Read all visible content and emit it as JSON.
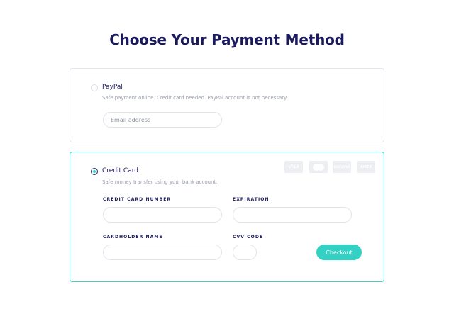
{
  "page": {
    "title": "Choose Your Payment Method"
  },
  "paypal": {
    "title": "PayPal",
    "description": "Safe payment online. Credit card needed. PayPal account is not necessary.",
    "email_placeholder": "Email address",
    "selected": false
  },
  "credit_card": {
    "title": "Credit Card",
    "description": "Safe money transfer using your bank account.",
    "selected": true,
    "card_number_label": "CREDIT CARD NUMBER",
    "expiration_label": "EXPIRATION",
    "cardholder_label": "CARDHOLDER NAME",
    "cvv_label": "CVV CODE",
    "checkout_label": "Checkout",
    "logos": {
      "visa": "VISA",
      "mastercard": "",
      "discover": "DISCOVER",
      "amex": "AMEX"
    }
  },
  "colors": {
    "heading": "#1c1a5e",
    "accent": "#33d1c4",
    "active_border": "#3fd2cc",
    "muted_text": "#9aa0ad"
  }
}
